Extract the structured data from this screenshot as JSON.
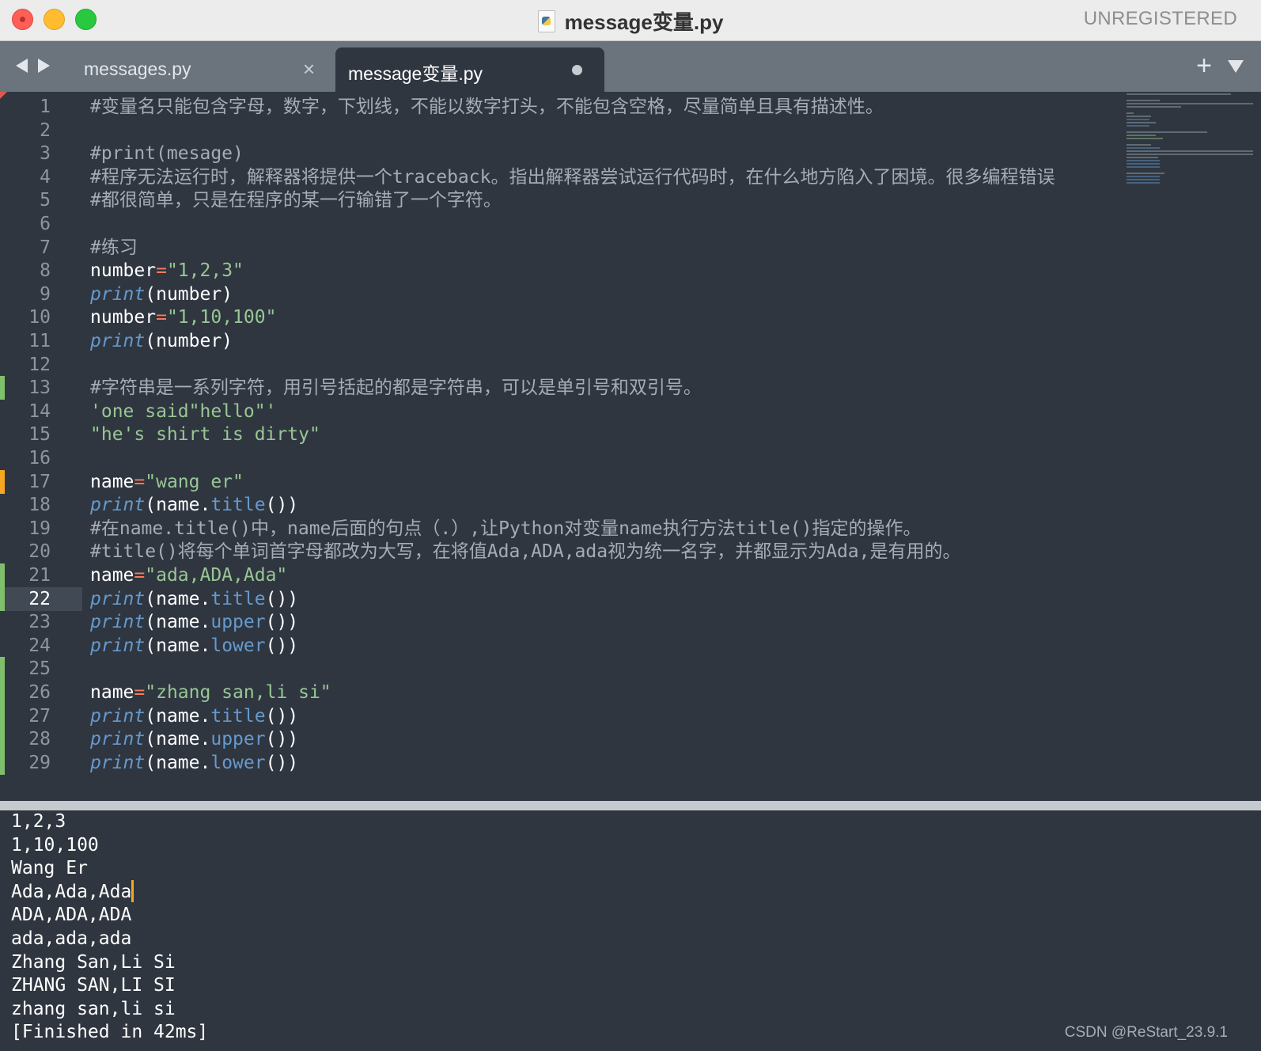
{
  "window": {
    "title": "message变量.py",
    "badge": "UNREGISTERED",
    "traffic_lights": [
      "close",
      "minimize",
      "zoom"
    ]
  },
  "tabs": [
    {
      "label": "messages.py",
      "active": false,
      "state_icon": "close-icon"
    },
    {
      "label": "message变量.py",
      "active": true,
      "state_icon": "unsaved-dot-icon"
    }
  ],
  "editor": {
    "current_line": 22,
    "lines": [
      {
        "n": "1",
        "mark": "",
        "tokens": [
          [
            "cmt",
            "#变量名只能包含字母，数字，下划线，不能以数字打头，不能包含空格，尽量简单且具有描述性。"
          ]
        ]
      },
      {
        "n": "2",
        "mark": "",
        "tokens": []
      },
      {
        "n": "3",
        "mark": "",
        "tokens": [
          [
            "cmt",
            "#print(mesage)"
          ]
        ]
      },
      {
        "n": "4",
        "mark": "",
        "tokens": [
          [
            "cmt",
            "#程序无法运行时，解释器将提供一个traceback。指出解释器尝试运行代码时，在什么地方陷入了困境。很多编程错误"
          ]
        ]
      },
      {
        "n": "5",
        "mark": "",
        "tokens": [
          [
            "cmt",
            "#都很简单，只是在程序的某一行输错了一个字符。"
          ]
        ]
      },
      {
        "n": "6",
        "mark": "",
        "tokens": []
      },
      {
        "n": "7",
        "mark": "",
        "tokens": [
          [
            "cmt",
            "#练习"
          ]
        ]
      },
      {
        "n": "8",
        "mark": "",
        "tokens": [
          [
            "pn",
            "number"
          ],
          [
            "op",
            "="
          ],
          [
            "str",
            "\"1,2,3\""
          ]
        ]
      },
      {
        "n": "9",
        "mark": "",
        "tokens": [
          [
            "fn",
            "print"
          ],
          [
            "pn",
            "(number)"
          ]
        ]
      },
      {
        "n": "10",
        "mark": "",
        "tokens": [
          [
            "pn",
            "number"
          ],
          [
            "op",
            "="
          ],
          [
            "str",
            "\"1,10,100\""
          ]
        ]
      },
      {
        "n": "11",
        "mark": "",
        "tokens": [
          [
            "fn",
            "print"
          ],
          [
            "pn",
            "(number)"
          ]
        ]
      },
      {
        "n": "12",
        "mark": "",
        "tokens": []
      },
      {
        "n": "13",
        "mark": "green",
        "tokens": [
          [
            "cmt",
            "#字符串是一系列字符，用引号括起的都是字符串，可以是单引号和双引号。"
          ]
        ]
      },
      {
        "n": "14",
        "mark": "",
        "tokens": [
          [
            "str",
            "'one said\"hello\"'"
          ]
        ]
      },
      {
        "n": "15",
        "mark": "",
        "tokens": [
          [
            "str",
            "\"he's shirt is dirty\""
          ]
        ]
      },
      {
        "n": "16",
        "mark": "",
        "tokens": []
      },
      {
        "n": "17",
        "mark": "orange",
        "tokens": [
          [
            "pn",
            "name"
          ],
          [
            "op",
            "="
          ],
          [
            "str",
            "\"wang er\""
          ]
        ]
      },
      {
        "n": "18",
        "mark": "",
        "tokens": [
          [
            "fn",
            "print"
          ],
          [
            "pn",
            "(name."
          ],
          [
            "meth",
            "title"
          ],
          [
            "pn",
            "())"
          ]
        ]
      },
      {
        "n": "19",
        "mark": "",
        "tokens": [
          [
            "cmt",
            "#在name.title()中，name后面的句点（.）,让Python对变量name执行方法title()指定的操作。"
          ]
        ]
      },
      {
        "n": "20",
        "mark": "",
        "tokens": [
          [
            "cmt",
            "#title()将每个单词首字母都改为大写，在将值Ada,ADA,ada视为统一名字，并都显示为Ada,是有用的。"
          ]
        ]
      },
      {
        "n": "21",
        "mark": "green",
        "tokens": [
          [
            "pn",
            "name"
          ],
          [
            "op",
            "="
          ],
          [
            "str",
            "\"ada,ADA,Ada\""
          ]
        ]
      },
      {
        "n": "22",
        "mark": "green",
        "tokens": [
          [
            "fn",
            "print"
          ],
          [
            "pn",
            "(name."
          ],
          [
            "meth",
            "title"
          ],
          [
            "pn",
            "())"
          ]
        ]
      },
      {
        "n": "23",
        "mark": "",
        "tokens": [
          [
            "fn",
            "print"
          ],
          [
            "pn",
            "(name."
          ],
          [
            "meth",
            "upper"
          ],
          [
            "pn",
            "())"
          ]
        ]
      },
      {
        "n": "24",
        "mark": "",
        "tokens": [
          [
            "fn",
            "print"
          ],
          [
            "pn",
            "(name."
          ],
          [
            "meth",
            "lower"
          ],
          [
            "pn",
            "())"
          ]
        ]
      },
      {
        "n": "25",
        "mark": "green",
        "tokens": []
      },
      {
        "n": "26",
        "mark": "green",
        "tokens": [
          [
            "pn",
            "name"
          ],
          [
            "op",
            "="
          ],
          [
            "str",
            "\"zhang san,li si\""
          ]
        ]
      },
      {
        "n": "27",
        "mark": "green",
        "tokens": [
          [
            "fn",
            "print"
          ],
          [
            "pn",
            "(name."
          ],
          [
            "meth",
            "title"
          ],
          [
            "pn",
            "())"
          ]
        ]
      },
      {
        "n": "28",
        "mark": "green",
        "tokens": [
          [
            "fn",
            "print"
          ],
          [
            "pn",
            "(name."
          ],
          [
            "meth",
            "upper"
          ],
          [
            "pn",
            "())"
          ]
        ]
      },
      {
        "n": "29",
        "mark": "green",
        "tokens": [
          [
            "fn",
            "print"
          ],
          [
            "pn",
            "(name."
          ],
          [
            "meth",
            "lower"
          ],
          [
            "pn",
            "())"
          ]
        ]
      }
    ]
  },
  "output": {
    "lines": [
      "1,2,3",
      "1,10,100",
      "Wang Er",
      "Ada,Ada,Ada",
      "ADA,ADA,ADA",
      "ada,ada,ada",
      "Zhang San,Li Si",
      "ZHANG SAN,LI SI",
      "zhang san,li si",
      "[Finished in 42ms]"
    ],
    "cursor_line": 3
  },
  "watermark": "CSDN @ReStart_23.9.1",
  "colors": {
    "background": "#2f3640",
    "comment": "#a4acb6",
    "string": "#99c794",
    "operator": "#f97b58",
    "function": "#6699cc",
    "gutter_green": "#7fbf6b",
    "gutter_orange": "#f5a623",
    "cursor": "#f5a623"
  }
}
